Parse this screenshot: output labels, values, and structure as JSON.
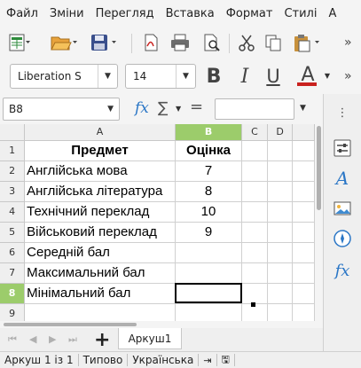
{
  "menu": [
    "Файл",
    "Зміни",
    "Перегляд",
    "Вставка",
    "Формат",
    "Стилі",
    "А"
  ],
  "toolbar": {
    "font_name": "Liberation S",
    "font_size": "14",
    "bold": "B",
    "italic": "I",
    "underline": "U",
    "font_color_letter": "A",
    "font_color": "#c9211e",
    "more": "»"
  },
  "formula_bar": {
    "cell_ref": "B8",
    "fx": "fx",
    "sum": "∑",
    "equals": "=",
    "value": ""
  },
  "grid": {
    "columns": [
      "A",
      "B",
      "C",
      "D"
    ],
    "rows": [
      {
        "n": "1",
        "a": "Предмет",
        "b": "Оцінка"
      },
      {
        "n": "2",
        "a": "Англійська мова",
        "b": "7"
      },
      {
        "n": "3",
        "a": "Англійська література",
        "b": "8"
      },
      {
        "n": "4",
        "a": "Технічний переклад",
        "b": "10"
      },
      {
        "n": "5",
        "a": "Військовий переклад",
        "b": "9"
      },
      {
        "n": "6",
        "a": "Середній бал",
        "b": ""
      },
      {
        "n": "7",
        "a": "Максимальний бал",
        "b": ""
      },
      {
        "n": "8",
        "a": "Мінімальний бал",
        "b": ""
      },
      {
        "n": "9",
        "a": "",
        "b": ""
      }
    ],
    "selected_cell": "B8",
    "selection_color": "#9ccc6b"
  },
  "sheet_tabs": {
    "add": "+",
    "active": "Аркуш1"
  },
  "status": {
    "sheet": "Аркуш 1 із 1",
    "style": "Типово",
    "language": "Українська"
  },
  "sidebar": {
    "fx": "fx"
  }
}
